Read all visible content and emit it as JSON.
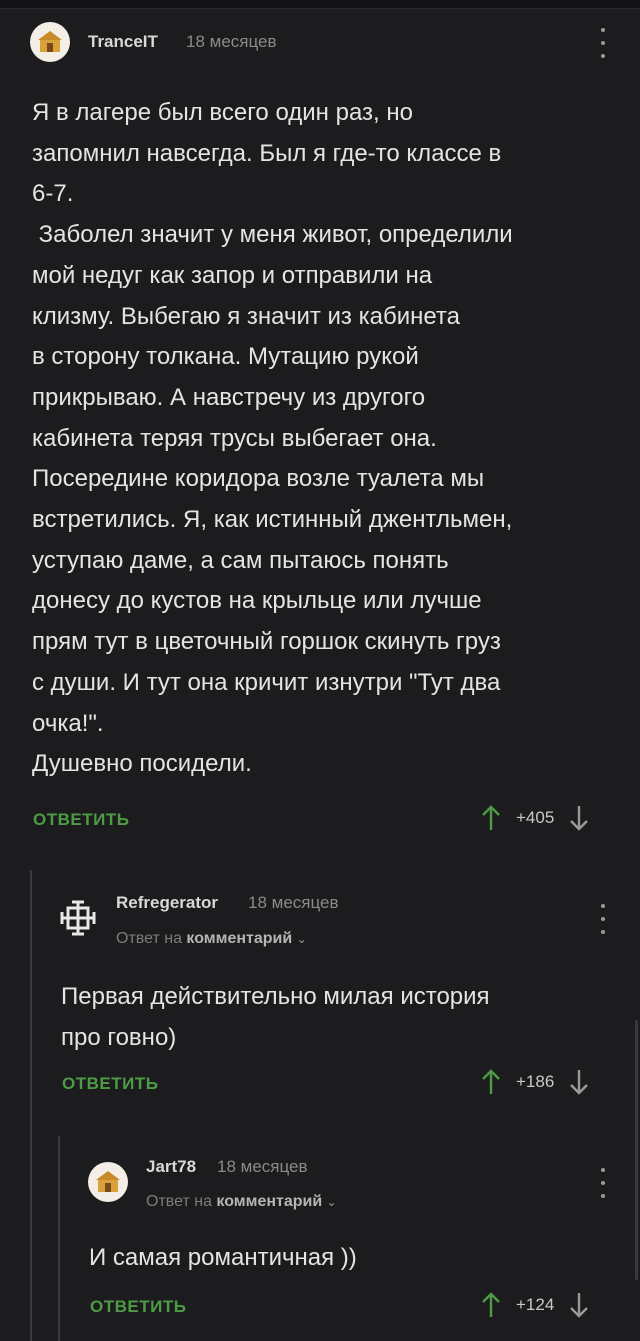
{
  "comments": [
    {
      "author": "TranceIT",
      "time": "18 месяцев",
      "text": "Я в лагере был всего один раз, но\nзапомнил навсегда. Был я где-то классе в\n6-7.\n Заболел значит у меня живот, определили\nмой недуг как запор и отправили на\nклизму. Выбегаю я значит из кабинета\nв сторону толкана. Мутацию рукой\nприкрываю. А навстречу из другого\nкабинета теряя трусы выбегает она.\nПосередине коридора возле туалета мы\nвстретились. Я, как истинный джентльмен,\nуступаю даме, а сам пытаюсь понять\nдонесу до кустов на крыльце или лучше\nпрям тут в цветочный горшок скинуть груз\nс души. И тут она кричит изнутри \"Тут два\nочка!\".\nДушевно посидели.",
      "reply_label": "ОТВЕТИТЬ",
      "score": "+405",
      "avatar_icon": "house-cake-avatar-icon"
    },
    {
      "author": "Refregerator",
      "time": "18 месяцев",
      "reply_prefix": "Ответ на",
      "reply_target": "комментарий",
      "text": "Первая действительно милая история\nпро говно)",
      "reply_label": "ОТВЕТИТЬ",
      "score": "+186",
      "avatar_icon": "cross-logo-avatar-icon"
    },
    {
      "author": "Jart78",
      "time": "18 месяцев",
      "reply_prefix": "Ответ на",
      "reply_target": "комментарий",
      "text": "И самая романтичная ))",
      "reply_label": "ОТВЕТИТЬ",
      "score": "+124",
      "avatar_icon": "house-cake-avatar-icon"
    }
  ],
  "colors": {
    "accent": "#4e9b45",
    "background": "#1c1c1e"
  }
}
